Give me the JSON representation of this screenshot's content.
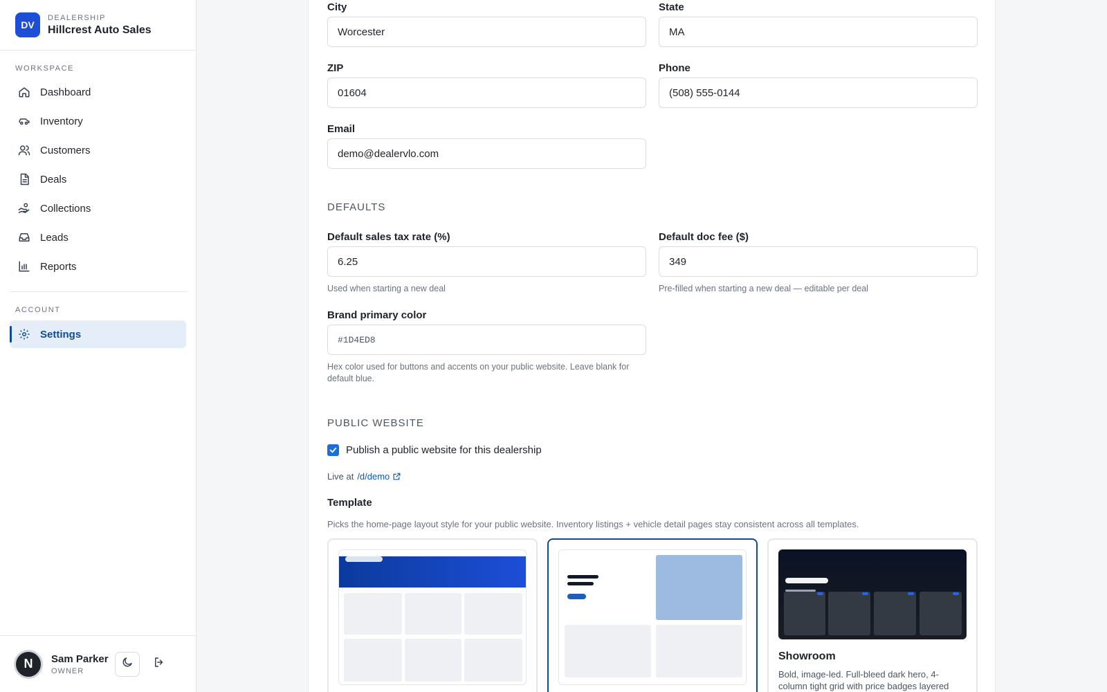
{
  "brand": {
    "logo_initials": "DV",
    "kicker": "DEALERSHIP",
    "name": "Hillcrest Auto Sales",
    "color": "#1d4ed8"
  },
  "sidebar": {
    "workspace_label": "WORKSPACE",
    "items": [
      {
        "label": "Dashboard",
        "icon": "home-icon"
      },
      {
        "label": "Inventory",
        "icon": "car-icon"
      },
      {
        "label": "Customers",
        "icon": "users-icon"
      },
      {
        "label": "Deals",
        "icon": "document-icon"
      },
      {
        "label": "Collections",
        "icon": "hand-coins-icon"
      },
      {
        "label": "Leads",
        "icon": "inbox-icon"
      },
      {
        "label": "Reports",
        "icon": "bar-chart-icon"
      }
    ],
    "account_label": "ACCOUNT",
    "account_items": [
      {
        "label": "Settings",
        "icon": "gear-icon",
        "active": true
      }
    ]
  },
  "user": {
    "initial": "N",
    "name": "Sam Parker",
    "role": "OWNER",
    "theme_icon": "moon-icon",
    "logout_icon": "logout-icon"
  },
  "form": {
    "city": {
      "label": "City",
      "value": "Worcester"
    },
    "state": {
      "label": "State",
      "value": "MA"
    },
    "zip": {
      "label": "ZIP",
      "value": "01604"
    },
    "phone": {
      "label": "Phone",
      "value": "(508) 555-0144"
    },
    "email": {
      "label": "Email",
      "value": "demo@dealervlo.com"
    },
    "defaults_heading": "DEFAULTS",
    "tax_rate": {
      "label": "Default sales tax rate (%)",
      "value": "6.25",
      "help": "Used when starting a new deal"
    },
    "doc_fee": {
      "label": "Default doc fee ($)",
      "value": "349",
      "help": "Pre-filled when starting a new deal — editable per deal"
    },
    "brand_color": {
      "label": "Brand primary color",
      "value": "#1D4ED8",
      "help": "Hex color used for buttons and accents on your public website. Leave blank for default blue."
    },
    "public_heading": "PUBLIC WEBSITE",
    "publish": {
      "checked": true,
      "label": "Publish a public website for this dealership"
    },
    "live": {
      "prefix": "Live at",
      "link": "/d/demo"
    },
    "template": {
      "label": "Template",
      "help": "Picks the home-page layout style for your public website. Inventory listings + vehicle detail pages stay consistent across all templates.",
      "cards": [
        {
          "id": "classic",
          "selected": false
        },
        {
          "id": "split",
          "selected": true
        },
        {
          "id": "showroom",
          "selected": false,
          "name": "Showroom",
          "desc": "Bold, image-led. Full-bleed dark hero, 4-column tight grid with price badges layered"
        }
      ]
    }
  },
  "colors": {
    "accent": "#0f4c91",
    "active_bg": "#e5edf8",
    "checkbox": "#1d6fd6"
  }
}
